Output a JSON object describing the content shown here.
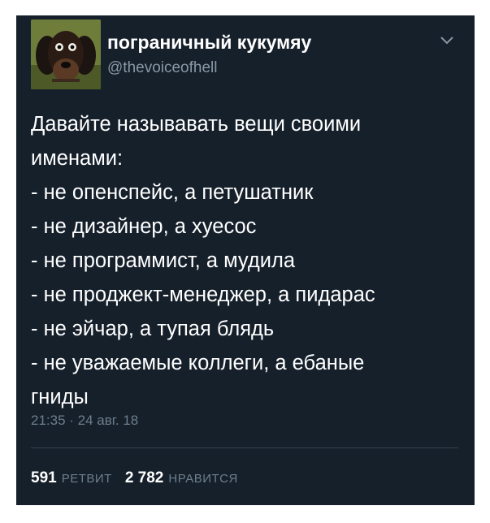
{
  "tweet": {
    "author_name": "пограничный кукумяу",
    "handle": "@thevoiceofhell",
    "text": "Давайте называвать вещи своими\nименами:\n- не опенспейс, а петушатник\n- не дизайнер, а хуесос\n- не программист, а мудила\n- не проджект-менеджер, а пидарас\n- не эйчар, а тупая блядь\n- не уважаемые коллеги, а ебаные\nгниды",
    "timestamp": "21:35 · 24 авг. 18"
  },
  "stats": {
    "retweets_count": "591",
    "retweets_label": "РЕТВИТ",
    "likes_count": "2 782",
    "likes_label": "НРАВИТСЯ"
  },
  "icons": {
    "avatar": "dog-avatar",
    "menu": "chevron-down-icon"
  },
  "colors": {
    "background": "#16202b",
    "text_primary": "#ffffff",
    "text_secondary": "#8899a6"
  }
}
